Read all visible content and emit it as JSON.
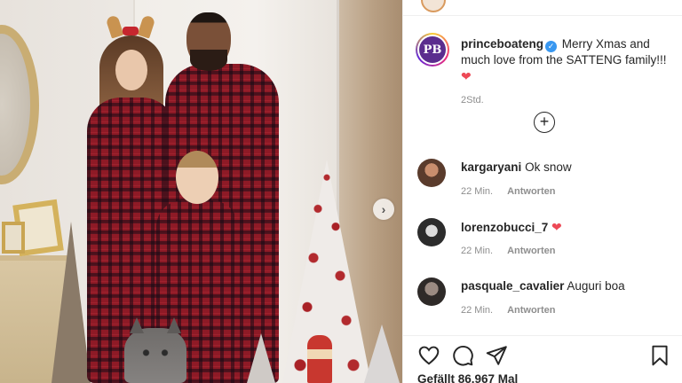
{
  "post": {
    "author": {
      "username": "princeboateng",
      "avatar_initials": "PB",
      "verified": true
    },
    "caption": "Merry Xmas and much love from the SATTENG family!!!",
    "caption_emoji": "❤",
    "time": "2Std.",
    "next_button_glyph": "›",
    "load_more_glyph": "+"
  },
  "comments": [
    {
      "username": "kargaryani",
      "text": "Ok snow",
      "emoji": "",
      "time": "22 Min.",
      "reply": "Antworten"
    },
    {
      "username": "lorenzobucci_7",
      "text": "",
      "emoji": "❤",
      "time": "22 Min.",
      "reply": "Antworten"
    },
    {
      "username": "pasquale_cavalier",
      "text": "Auguri boa",
      "emoji": "",
      "time": "22 Min.",
      "reply": "Antworten"
    }
  ],
  "footer": {
    "likes": "Gefällt 86.967 Mal"
  },
  "colors": {
    "verified": "#3897f0",
    "heart": "#ed4956",
    "meta_text": "#8e8e8e",
    "text": "#262626"
  },
  "icons": [
    "heart-outline-icon",
    "comment-icon",
    "share-icon",
    "bookmark-icon",
    "plus-circle-icon",
    "chevron-right-icon",
    "verified-badge-icon"
  ]
}
